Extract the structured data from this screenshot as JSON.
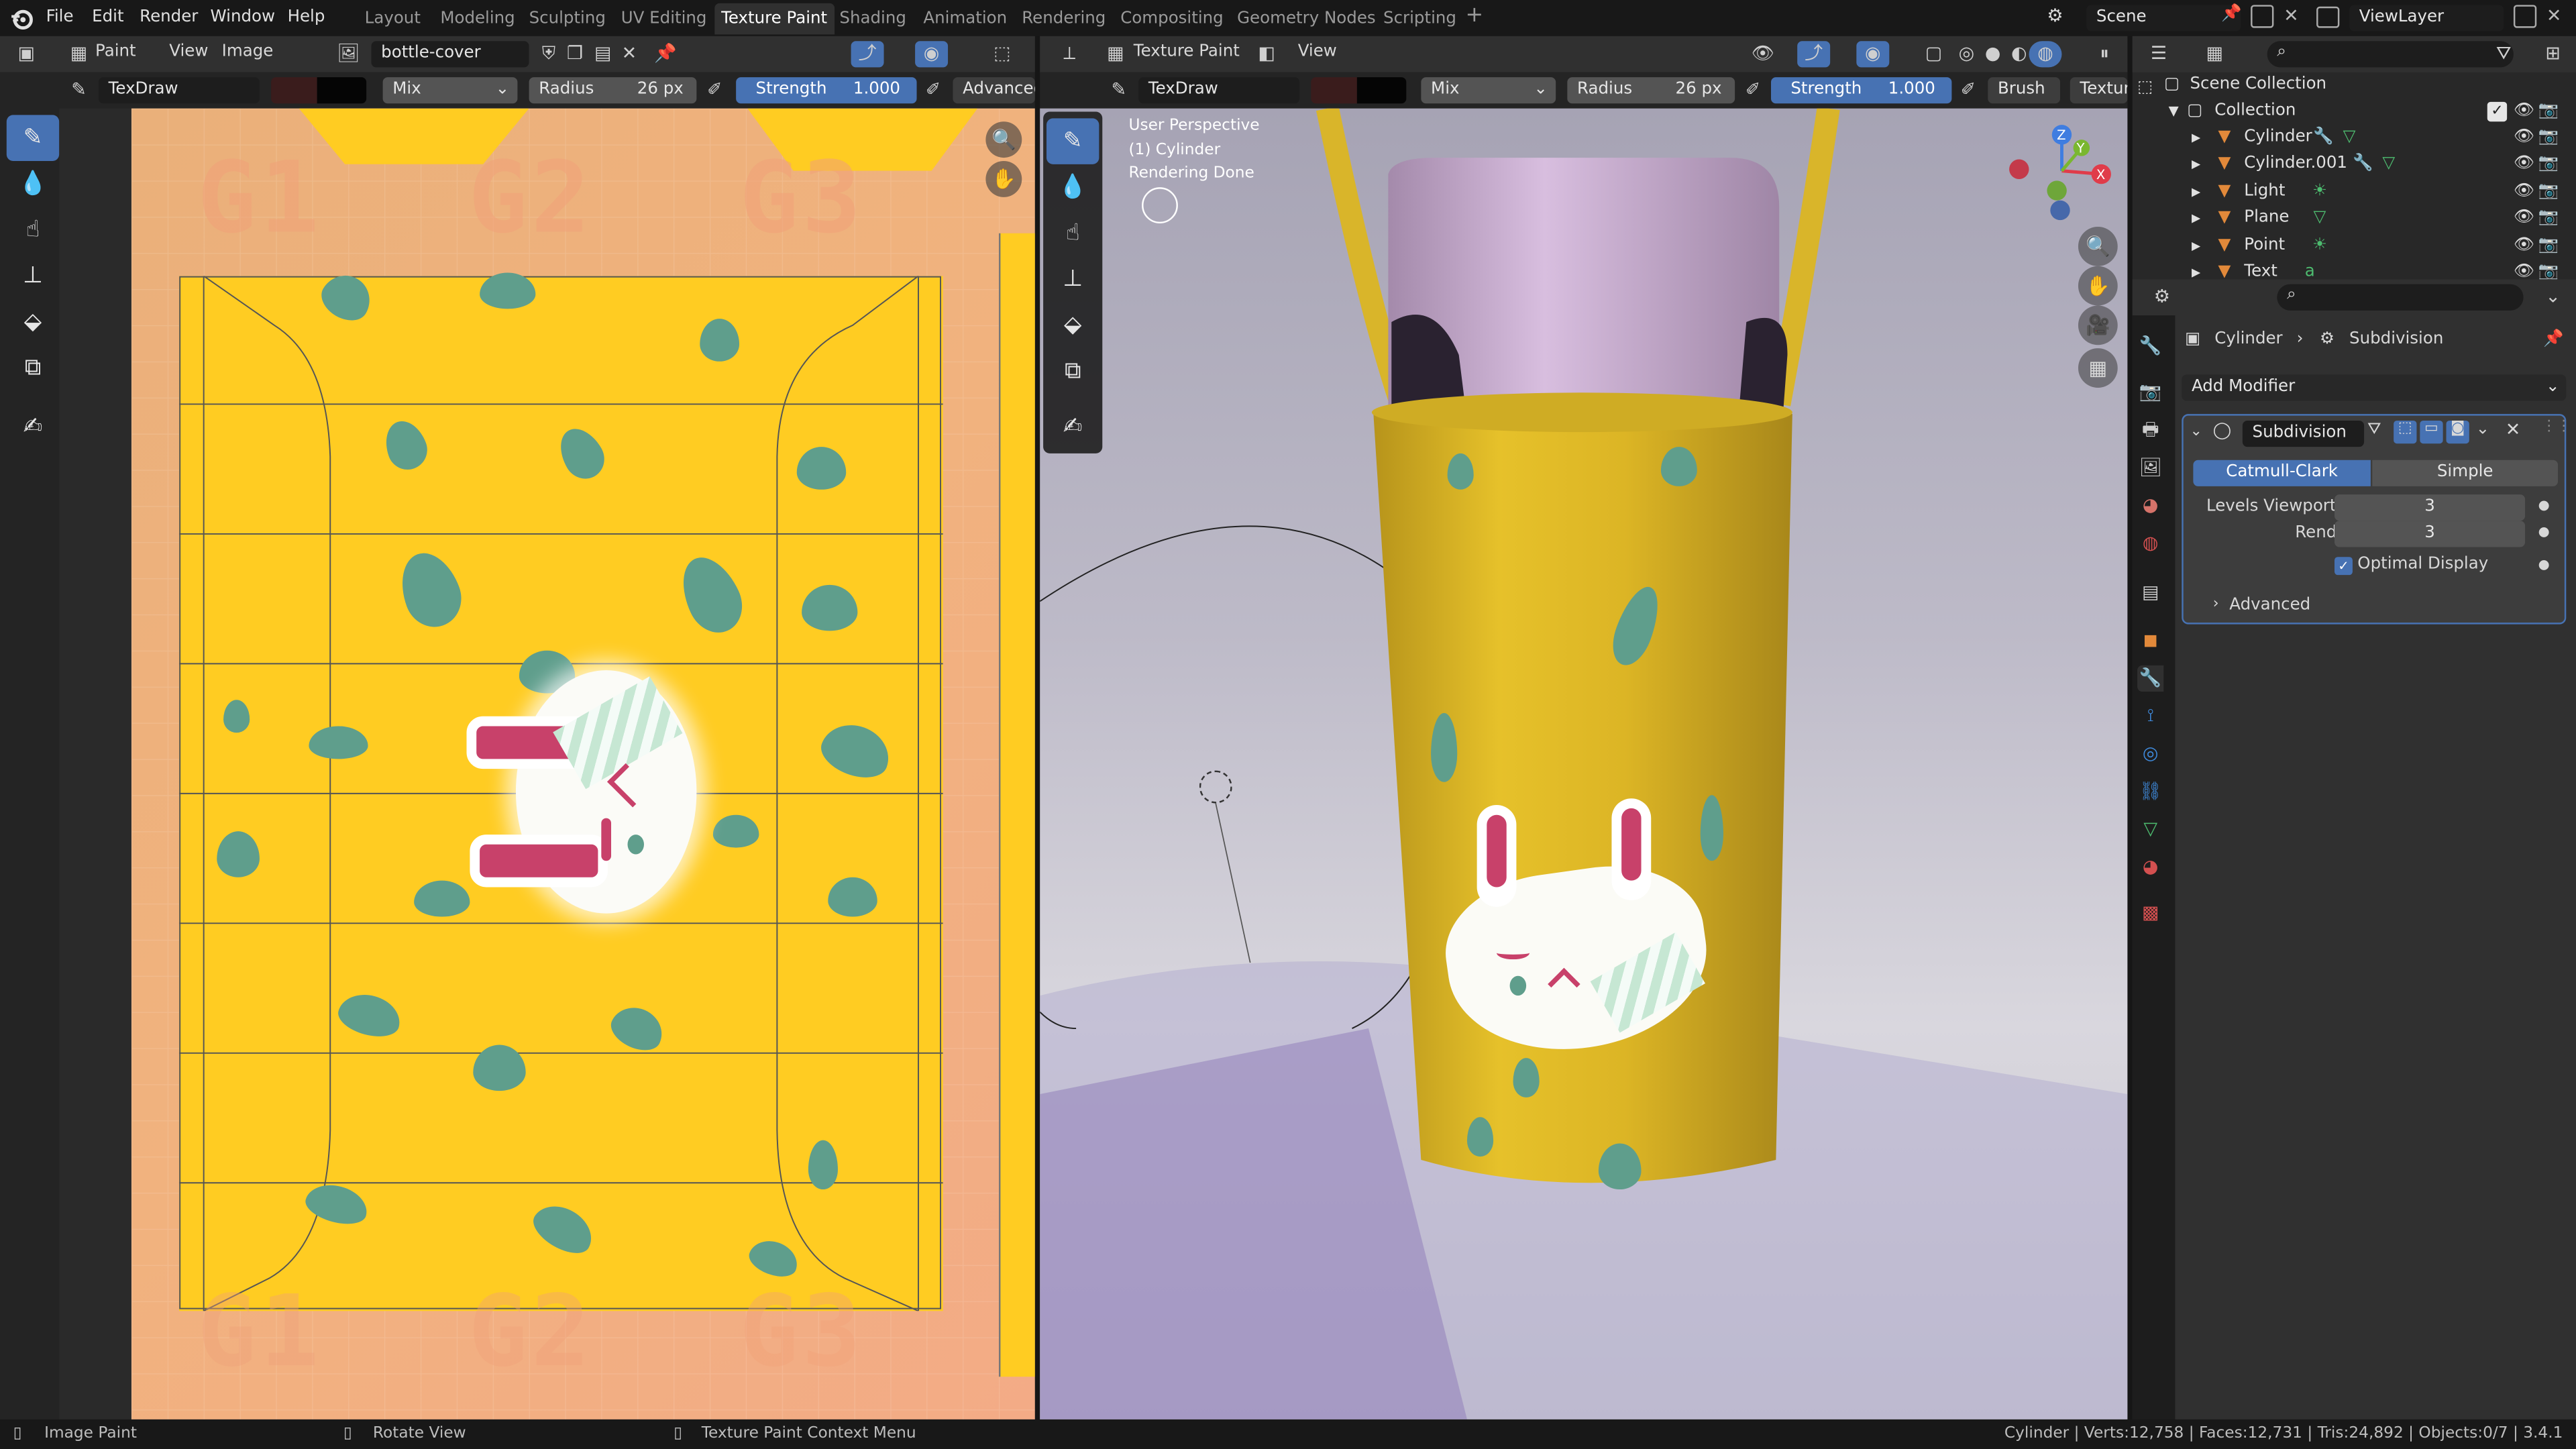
{
  "app": {
    "logo": "blender-logo-icon"
  },
  "menu": [
    "File",
    "Edit",
    "Render",
    "Window",
    "Help"
  ],
  "workspaces": [
    "Layout",
    "Modeling",
    "Sculpting",
    "UV Editing",
    "Texture Paint",
    "Shading",
    "Animation",
    "Rendering",
    "Compositing",
    "Geometry Nodes",
    "Scripting"
  ],
  "active_workspace": "Texture Paint",
  "scene": "Scene",
  "view_layer": "ViewLayer",
  "image_editor": {
    "mode": "Paint",
    "menus": [
      "View",
      "Image"
    ],
    "image_name": "bottle-cover",
    "brush": "TexDraw",
    "blend": "Mix",
    "radius_label": "Radius",
    "radius_value": "26 px",
    "strength_label": "Strength",
    "strength_value": "1.000",
    "advanced_label": "Advanced",
    "guide_top": [
      "G1",
      "G2",
      "G3"
    ],
    "guide_bottom": [
      "G1",
      "G2",
      "G3"
    ]
  },
  "viewport": {
    "mode": "Texture Paint",
    "menus": [
      "View"
    ],
    "brush": "TexDraw",
    "blend": "Mix",
    "radius_label": "Radius",
    "radius_value": "26 px",
    "strength_label": "Strength",
    "strength_value": "1.000",
    "brush_menu": "Brush",
    "texture_menu": "Texture",
    "overlay_lines": [
      "User Perspective",
      "(1) Cylinder",
      "Rendering Done"
    ],
    "gizmo_axes": [
      "X",
      "Y",
      "Z"
    ]
  },
  "outliner": {
    "root": "Scene Collection",
    "collection": "Collection",
    "items": [
      {
        "name": "Cylinder",
        "icon": "mesh-icon"
      },
      {
        "name": "Cylinder.001",
        "icon": "mesh-icon"
      },
      {
        "name": "Light",
        "icon": "light-icon"
      },
      {
        "name": "Plane",
        "icon": "mesh-icon"
      },
      {
        "name": "Point",
        "icon": "light-icon"
      },
      {
        "name": "Text",
        "icon": "text-icon"
      }
    ]
  },
  "properties": {
    "breadcrumb_object": "Cylinder",
    "breadcrumb_modifier": "Subdivision",
    "add_modifier": "Add Modifier",
    "modifier_name": "Subdivision",
    "tabs": [
      "Catmull-Clark",
      "Simple"
    ],
    "active_tab": "Catmull-Clark",
    "levels_viewport_label": "Levels Viewport",
    "levels_viewport": "3",
    "render_label": "Render",
    "render_value": "3",
    "optimal_display": "Optimal Display",
    "optimal_checked": true,
    "advanced": "Advanced"
  },
  "statusbar": {
    "left": "Image Paint",
    "mid": "Rotate View",
    "right_hint": "Texture Paint Context Menu",
    "stats": "Cylinder | Verts:12,758 | Faces:12,731 | Tris:24,892 | Objects:0/7 | 3.4.1"
  },
  "colors": {
    "accent": "#4772b3",
    "texture_yellow": "#ffcc22",
    "spot": "#5f9e8c",
    "bg": "#1d1d1d",
    "panel": "#303030"
  }
}
